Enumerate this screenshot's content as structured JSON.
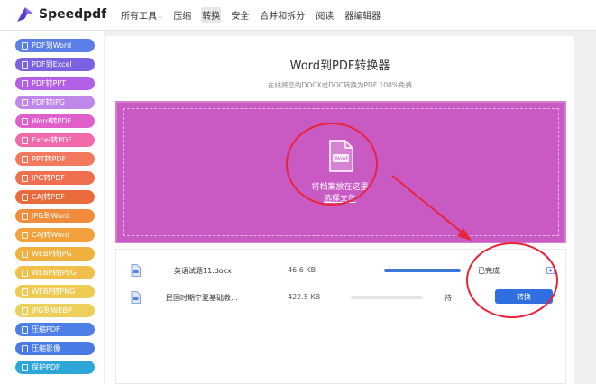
{
  "brand": {
    "name": "Speedpdf"
  },
  "nav": {
    "items": [
      {
        "label": "所有工具",
        "has_caret": true
      },
      {
        "label": "压缩"
      },
      {
        "label": "转换",
        "active": true
      },
      {
        "label": "安全"
      },
      {
        "label": "合并和拆分"
      },
      {
        "label": "阅读"
      },
      {
        "label": "器编辑器"
      }
    ]
  },
  "sidebar": {
    "items": [
      {
        "label": "PDF到Word",
        "color": "#5b7ee8"
      },
      {
        "label": "PDF到Excel",
        "color": "#7b62e0"
      },
      {
        "label": "PDF转PPT",
        "color": "#b35fe6"
      },
      {
        "label": "PDF转JPG",
        "color": "#c087ea"
      },
      {
        "label": "Word转PDF",
        "color": "#e05fcb"
      },
      {
        "label": "Excel转PDF",
        "color": "#f06aa9"
      },
      {
        "label": "PPT转PDF",
        "color": "#f3795e"
      },
      {
        "label": "JPG转PDF",
        "color": "#f06f4f"
      },
      {
        "label": "CAJ转PDF",
        "color": "#e96a3a"
      },
      {
        "label": "JPG到Word",
        "color": "#f18c3d"
      },
      {
        "label": "CAJ转Word",
        "color": "#f2a13c"
      },
      {
        "label": "WEBP转JPG",
        "color": "#f0b040"
      },
      {
        "label": "WEBP转JPEG",
        "color": "#f0c04a"
      },
      {
        "label": "WEBP转PNG",
        "color": "#eecb55"
      },
      {
        "label": "JPG到WEBP",
        "color": "#eccf5c"
      },
      {
        "label": "压缩PDF",
        "color": "#4e7fe6"
      },
      {
        "label": "压缩影像",
        "color": "#4a7be4"
      },
      {
        "label": "保护PDF",
        "color": "#2fa6d8"
      }
    ]
  },
  "main": {
    "title": "Word到PDF转换器",
    "subtitle": "在线将您的DOCX或DOC转换为PDF 100%免费",
    "dropzone": {
      "icon_label": "Word",
      "hint": "将档案放在这里",
      "select_label": "选择文件",
      "bg_color": "#c95ac4"
    },
    "files": [
      {
        "name": "英语试题11.docx",
        "size": "46.6 KB",
        "progress": 1.0,
        "status": "已完成",
        "done": true
      },
      {
        "name": "民国时期宁夏基础教...",
        "size": "422.5 KB",
        "progress": 0.0,
        "status": "待",
        "action_label": "转换",
        "done": false
      }
    ]
  }
}
